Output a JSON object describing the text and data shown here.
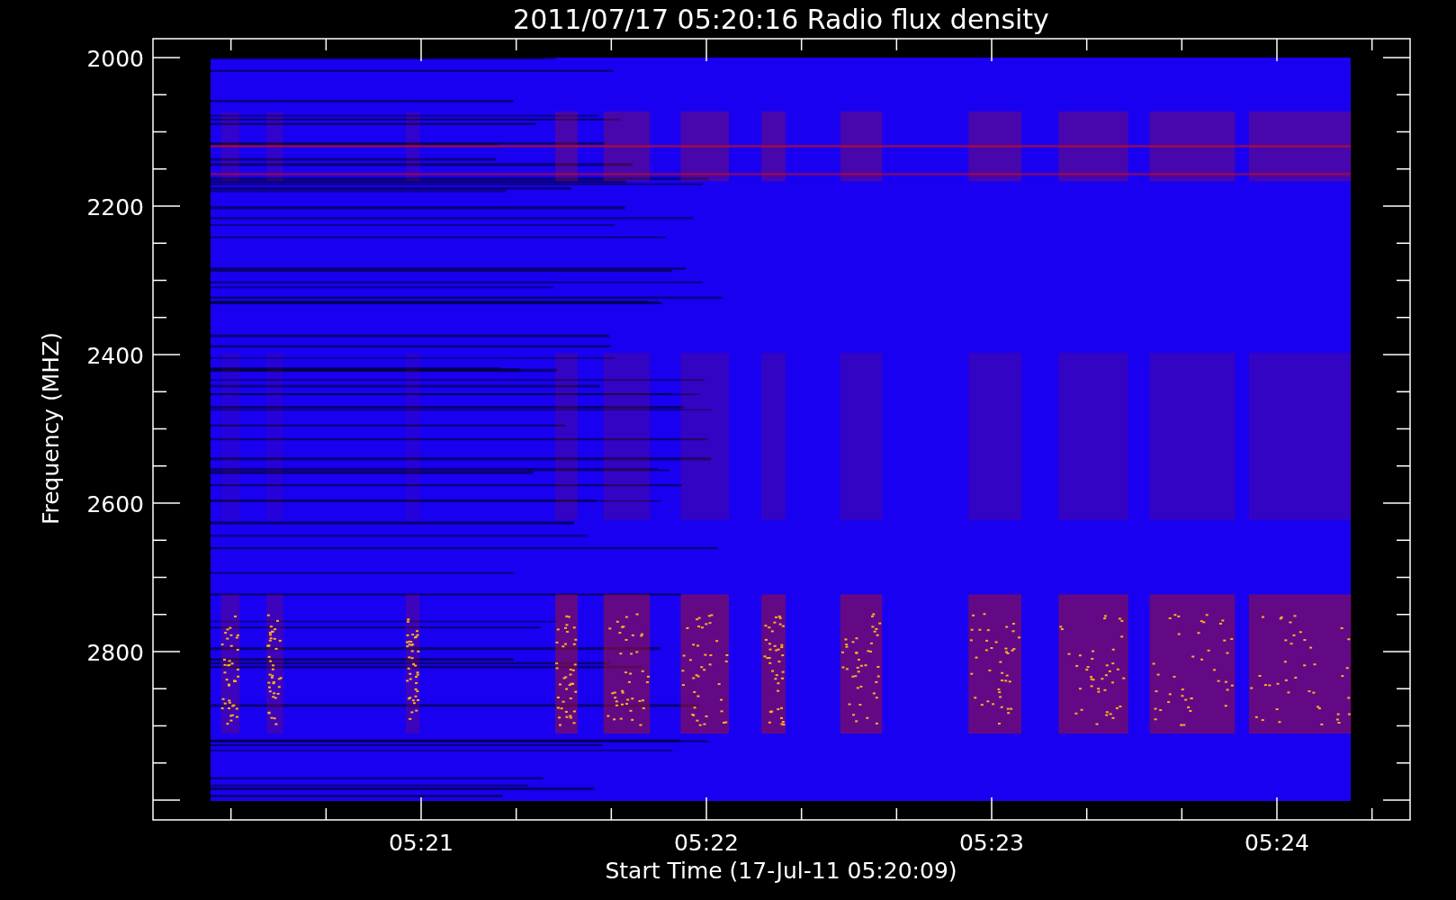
{
  "title": "2011/07/17 05:20:16 Radio flux density",
  "y_axis": {
    "label": "Frequency (MHZ)",
    "ticks": [
      "2000",
      "2200",
      "2400",
      "2600",
      "2800"
    ]
  },
  "x_axis": {
    "label": "Start Time (17-Jul-11 05:20:09)",
    "ticks": [
      "05:21",
      "05:22",
      "05:23",
      "05:24"
    ]
  }
}
